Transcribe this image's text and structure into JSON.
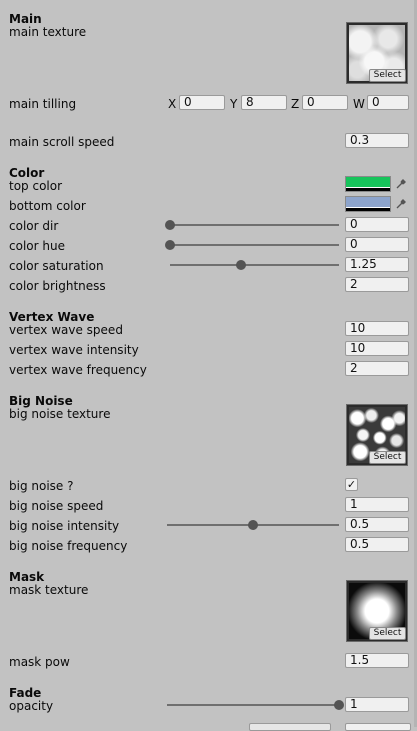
{
  "main": {
    "header": "Main",
    "texture_label": "main texture",
    "select_label": "Select",
    "tilling_label": "main tilling",
    "tilling": [
      {
        "axis": "X",
        "value": "0"
      },
      {
        "axis": "Y",
        "value": "8"
      },
      {
        "axis": "Z",
        "value": "0"
      },
      {
        "axis": "W",
        "value": "0"
      }
    ],
    "scroll_label": "main scroll speed",
    "scroll_value": "0.3"
  },
  "color": {
    "header": "Color",
    "top_label": "top color",
    "top_color": "#17c45b",
    "bottom_label": "bottom color",
    "bottom_color": "#8da4cc",
    "dir_label": "color dir",
    "dir_value": "0",
    "dir_level": 0,
    "hue_label": "color hue",
    "hue_value": "0",
    "hue_level": 0,
    "saturation_label": "color saturation",
    "saturation_value": "1.25",
    "saturation_level": 0.42,
    "brightness_label": "color brightness",
    "brightness_value": "2"
  },
  "vertex_wave": {
    "header": "Vertex Wave",
    "speed_label": "vertex wave speed",
    "speed_value": "10",
    "intensity_label": "vertex wave intensity",
    "intensity_value": "10",
    "frequency_label": "vertex wave frequency",
    "frequency_value": "2"
  },
  "big_noise": {
    "header": "Big Noise",
    "texture_label": "big noise texture",
    "select_label": "Select",
    "toggle_label": "big noise ?",
    "toggle_checked": true,
    "speed_label": "big noise speed",
    "speed_value": "1",
    "intensity_label": "big noise intensity",
    "intensity_value": "0.5",
    "intensity_level": 0.5,
    "frequency_label": "big noise frequency",
    "frequency_value": "0.5"
  },
  "mask": {
    "header": "Mask",
    "texture_label": "mask texture",
    "select_label": "Select",
    "pow_label": "mask pow",
    "pow_value": "1.5"
  },
  "fade": {
    "header": "Fade",
    "opacity_label": "opacity",
    "opacity_value": "1",
    "opacity_level": 1
  }
}
